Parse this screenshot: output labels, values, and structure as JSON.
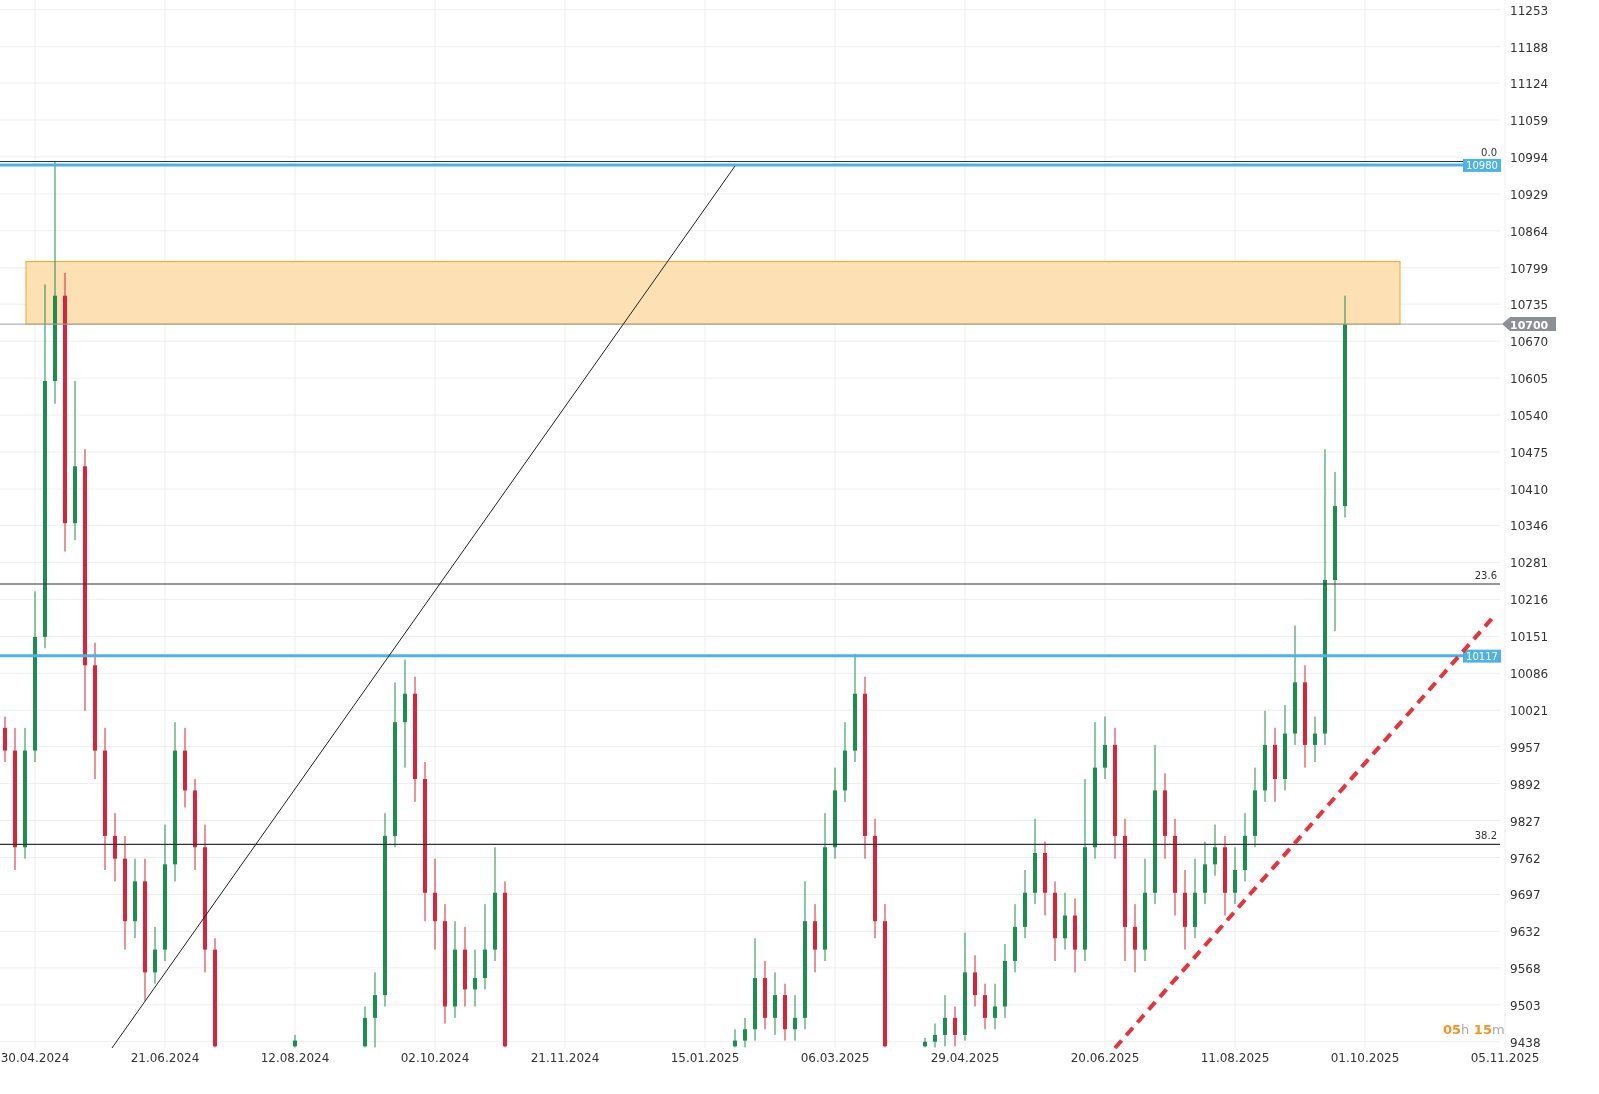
{
  "chart": {
    "chart_data": {
      "type": "candlestick",
      "grid": true,
      "ylim": [
        9427,
        11270
      ],
      "yticks": [
        9438,
        9503,
        9568,
        9632,
        9697,
        9762,
        9827,
        9892,
        9957,
        10021,
        10086,
        10151,
        10216,
        10281,
        10346,
        10410,
        10475,
        10540,
        10605,
        10670,
        10735,
        10799,
        10864,
        10929,
        10994,
        11059,
        11124,
        11188,
        11253
      ],
      "categories": [
        null,
        null,
        null,
        "30.04.2024",
        null,
        null,
        null,
        null,
        null,
        null,
        null,
        null,
        null,
        null,
        null,
        null,
        "21.06.2024",
        null,
        null,
        null,
        null,
        null,
        null,
        null,
        null,
        null,
        null,
        null,
        null,
        "12.08.2024",
        null,
        null,
        null,
        null,
        null,
        null,
        null,
        null,
        null,
        null,
        null,
        null,
        null,
        "02.10.2024",
        null,
        null,
        null,
        null,
        null,
        null,
        null,
        null,
        null,
        null,
        null,
        null,
        "21.11.2024",
        null,
        null,
        null,
        null,
        null,
        null,
        null,
        null,
        null,
        null,
        null,
        null,
        null,
        "15.01.2025",
        null,
        null,
        null,
        null,
        null,
        null,
        null,
        null,
        null,
        null,
        null,
        null,
        "06.03.2025",
        null,
        null,
        null,
        null,
        null,
        null,
        null,
        null,
        null,
        null,
        null,
        null,
        "29.04.2025",
        null,
        null,
        null,
        null,
        null,
        null,
        null,
        null,
        null,
        null,
        null,
        null,
        null,
        "20.06.2025",
        null,
        null,
        null,
        null,
        null,
        null,
        null,
        null,
        null,
        null,
        null,
        null,
        "11.08.2025",
        null,
        null,
        null,
        null,
        null,
        null,
        null,
        null,
        null,
        null,
        null,
        null,
        "01.10.2025",
        null,
        null,
        null,
        null,
        null,
        null,
        null,
        null,
        null,
        null,
        null,
        null,
        null,
        "05.11.2025"
      ],
      "ohlc": [
        [
          9990,
          10010,
          9930,
          9950
        ],
        [
          9950,
          9990,
          9740,
          9780
        ],
        [
          9780,
          9990,
          9760,
          9950
        ],
        [
          9950,
          10230,
          9930,
          10150
        ],
        [
          10150,
          10770,
          10130,
          10600
        ],
        [
          10600,
          10985,
          10560,
          10750
        ],
        [
          10750,
          10790,
          10300,
          10350
        ],
        [
          10350,
          10600,
          10320,
          10450
        ],
        [
          10450,
          10480,
          10020,
          10100
        ],
        [
          10100,
          10140,
          9900,
          9950
        ],
        [
          9950,
          9990,
          9740,
          9800
        ],
        [
          9800,
          9840,
          9720,
          9760
        ],
        [
          9760,
          9800,
          9600,
          9650
        ],
        [
          9650,
          9760,
          9620,
          9720
        ],
        [
          9720,
          9760,
          9510,
          9560
        ],
        [
          9560,
          9640,
          9540,
          9600
        ],
        [
          9600,
          9820,
          9580,
          9750
        ],
        [
          9750,
          10000,
          9720,
          9950
        ],
        [
          9950,
          9990,
          9850,
          9880
        ],
        [
          9880,
          9900,
          9740,
          9780
        ],
        [
          9780,
          9820,
          9560,
          9600
        ],
        [
          9600,
          9620,
          9428,
          9430
        ],
        null,
        null,
        null,
        null,
        null,
        null,
        null,
        [
          9430,
          9450,
          9428,
          9440
        ],
        null,
        null,
        null,
        null,
        null,
        null,
        [
          9430,
          9500,
          9428,
          9480
        ],
        [
          9480,
          9560,
          9428,
          9520
        ],
        [
          9520,
          9840,
          9500,
          9800
        ],
        [
          9800,
          10070,
          9780,
          10000
        ],
        [
          10000,
          10110,
          9920,
          10050
        ],
        [
          10050,
          10080,
          9860,
          9900
        ],
        [
          9900,
          9930,
          9650,
          9700
        ],
        [
          9700,
          9760,
          9600,
          9650
        ],
        [
          9650,
          9680,
          9470,
          9500
        ],
        [
          9500,
          9650,
          9480,
          9600
        ],
        [
          9600,
          9640,
          9500,
          9530
        ],
        [
          9530,
          9600,
          9500,
          9550
        ],
        [
          9550,
          9680,
          9530,
          9600
        ],
        [
          9600,
          9780,
          9580,
          9700
        ],
        [
          9700,
          9720,
          9428,
          9430
        ],
        null,
        null,
        null,
        null,
        null,
        null,
        null,
        null,
        null,
        null,
        null,
        null,
        null,
        null,
        null,
        null,
        null,
        null,
        null,
        null,
        null,
        null,
        [
          9430,
          9460,
          9428,
          9440
        ],
        [
          9440,
          9480,
          9428,
          9460
        ],
        [
          9460,
          9620,
          9440,
          9550
        ],
        [
          9550,
          9580,
          9460,
          9480
        ],
        [
          9480,
          9560,
          9450,
          9520
        ],
        [
          9520,
          9540,
          9440,
          9460
        ],
        [
          9460,
          9520,
          9440,
          9480
        ],
        [
          9480,
          9720,
          9460,
          9650
        ],
        [
          9650,
          9680,
          9560,
          9600
        ],
        [
          9600,
          9840,
          9580,
          9780
        ],
        [
          9780,
          9920,
          9760,
          9880
        ],
        [
          9880,
          10000,
          9860,
          9950
        ],
        [
          9950,
          10120,
          9930,
          10050
        ],
        [
          10050,
          10080,
          9760,
          9800
        ],
        [
          9800,
          9830,
          9620,
          9650
        ],
        [
          9650,
          9680,
          9428,
          9430
        ],
        null,
        null,
        null,
        [
          9430,
          9445,
          9428,
          9438
        ],
        [
          9438,
          9470,
          9428,
          9450
        ],
        [
          9450,
          9520,
          9430,
          9480
        ],
        [
          9480,
          9500,
          9430,
          9450
        ],
        [
          9450,
          9630,
          9440,
          9560
        ],
        [
          9560,
          9590,
          9500,
          9520
        ],
        [
          9520,
          9540,
          9460,
          9480
        ],
        [
          9480,
          9540,
          9460,
          9500
        ],
        [
          9500,
          9610,
          9480,
          9580
        ],
        [
          9580,
          9680,
          9560,
          9640
        ],
        [
          9640,
          9740,
          9620,
          9700
        ],
        [
          9700,
          9830,
          9680,
          9770
        ],
        [
          9770,
          9790,
          9660,
          9700
        ],
        [
          9700,
          9720,
          9580,
          9620
        ],
        [
          9620,
          9700,
          9600,
          9660
        ],
        [
          9660,
          9690,
          9560,
          9600
        ],
        [
          9600,
          9900,
          9580,
          9780
        ],
        [
          9780,
          10000,
          9760,
          9920
        ],
        [
          9920,
          10010,
          9900,
          9960
        ],
        [
          9960,
          9990,
          9760,
          9800
        ],
        [
          9800,
          9830,
          9580,
          9640
        ],
        [
          9640,
          9680,
          9560,
          9600
        ],
        [
          9600,
          9760,
          9580,
          9700
        ],
        [
          9700,
          9960,
          9680,
          9880
        ],
        [
          9880,
          9910,
          9760,
          9800
        ],
        [
          9800,
          9830,
          9660,
          9700
        ],
        [
          9700,
          9740,
          9600,
          9640
        ],
        [
          9640,
          9760,
          9620,
          9700
        ],
        [
          9700,
          9790,
          9680,
          9750
        ],
        [
          9750,
          9820,
          9730,
          9780
        ],
        [
          9780,
          9800,
          9660,
          9700
        ],
        [
          9700,
          9780,
          9680,
          9740
        ],
        [
          9740,
          9840,
          9720,
          9800
        ],
        [
          9800,
          9920,
          9780,
          9880
        ],
        [
          9880,
          10020,
          9860,
          9960
        ],
        [
          9960,
          9990,
          9860,
          9900
        ],
        [
          9900,
          10030,
          9880,
          9980
        ],
        [
          9980,
          10170,
          9960,
          10070
        ],
        [
          10070,
          10100,
          9920,
          9960
        ],
        [
          9960,
          10010,
          9930,
          9980
        ],
        [
          9980,
          10480,
          9960,
          10250
        ],
        [
          10250,
          10440,
          10160,
          10380
        ],
        [
          10380,
          10750,
          10360,
          10700
        ],
        null,
        null,
        null,
        null,
        null,
        null,
        null,
        null,
        null,
        null,
        null,
        null,
        null,
        null,
        null,
        null
      ],
      "ref_lines": [
        {
          "axis": "y",
          "value": 10986,
          "color": "#333333"
        },
        {
          "axis": "y",
          "value": 10980,
          "label": "10980",
          "color": "#4db3e6"
        },
        {
          "axis": "y",
          "value": 10700,
          "label": "10700",
          "color": "#9aa0a6"
        },
        {
          "axis": "y",
          "value": 10243,
          "color": "#333333"
        },
        {
          "axis": "y",
          "value": 10117,
          "label": "10117",
          "color": "#4db3e6"
        },
        {
          "axis": "y",
          "value": 9785,
          "color": "#333333"
        }
      ],
      "bands": [
        {
          "axis": "y",
          "from": 10700,
          "to": 10810
        }
      ],
      "annotations": [
        "0.0",
        "23.6",
        "38.2"
      ]
    }
  },
  "countdown": [
    {
      "text": "05",
      "kind": "number"
    },
    {
      "text": "h",
      "kind": "unit"
    },
    {
      "text": " 15",
      "kind": "number"
    },
    {
      "text": "m",
      "kind": "unit"
    }
  ]
}
